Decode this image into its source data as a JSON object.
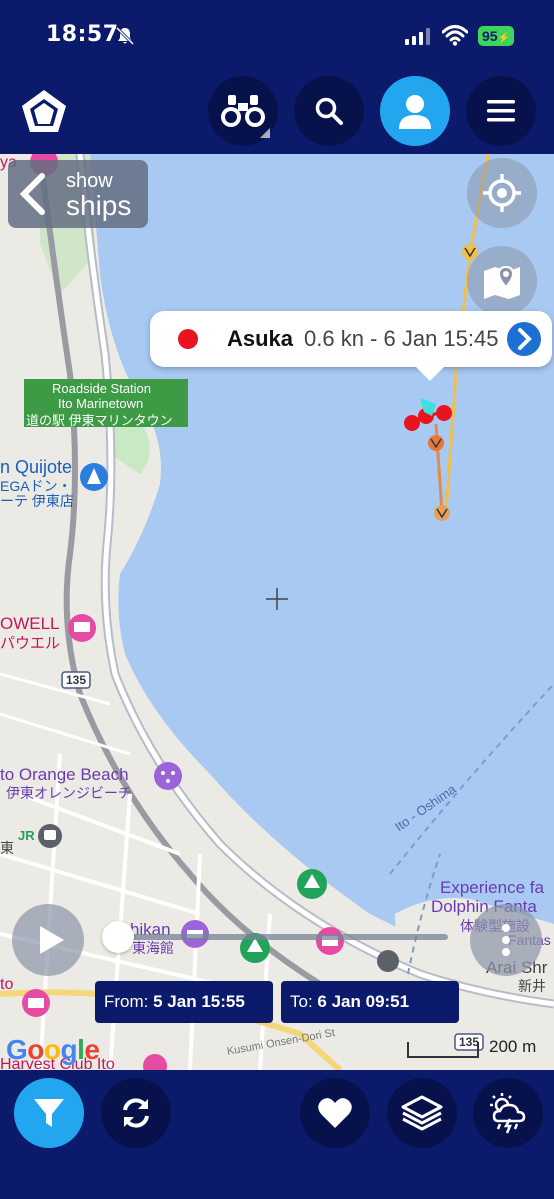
{
  "status_bar": {
    "time": "18:57",
    "battery": "95",
    "icons": [
      "bell-slash-icon",
      "signal-icon",
      "wifi-icon",
      "battery-icon"
    ]
  },
  "toolbar": {
    "icons": [
      "home-logo-icon",
      "binoculars-icon",
      "search-icon",
      "user-icon",
      "menu-icon"
    ],
    "active_color": "#22a6f0"
  },
  "map": {
    "show_ships": {
      "line1": "show",
      "line2": "ships"
    },
    "labels": {
      "roadside_station_1": "Roadside Station",
      "roadside_station_2": "Ito Marinetown",
      "roadside_station_3": "道の駅 伊東マリンタウン",
      "quijote_1": "n Quijote",
      "quijote_2": "EGAドン・",
      "quijote_3": "ーテ 伊東店",
      "owell_1": "OWELL",
      "owell_2": "パウエル",
      "route_135": "135",
      "route_135_b": "135",
      "orange_beach_1": "to Orange Beach",
      "orange_beach_2": "伊東オレンジビーチ",
      "jr_label": "JR",
      "east_label": "東",
      "tohikan_1": "Tohikan",
      "tohikan_2": "東海館",
      "to_oshima": "Ito - Oshima",
      "dolphin_1": "Experience fa",
      "dolphin_2": "Dolphin Fanta",
      "dolphin_3": "体験型施設",
      "dolphin_4": "Fantas",
      "arai_1": "Arai Shr",
      "arai_2": "新井",
      "to_label": "to",
      "harvest": "Harvest Club Ito",
      "kusumi": "Kusumi Onsen-Dori St",
      "ya_label": "ya"
    },
    "ship_popup": {
      "name": "Asuka",
      "info": "0.6 kn - 6 Jan 15:45",
      "status_color": "#e8141e"
    },
    "timeline": {
      "from_label": "From:",
      "from_value": "5 Jan 15:55",
      "to_label": "To:",
      "to_value": "6 Jan 09:51",
      "progress": 0.0
    },
    "attribution": "Google",
    "scale": "200 m"
  },
  "bottom_toolbar": {
    "icons": [
      "filter-icon",
      "refresh-icon",
      "heart-icon",
      "layers-icon",
      "weather-icon"
    ]
  }
}
